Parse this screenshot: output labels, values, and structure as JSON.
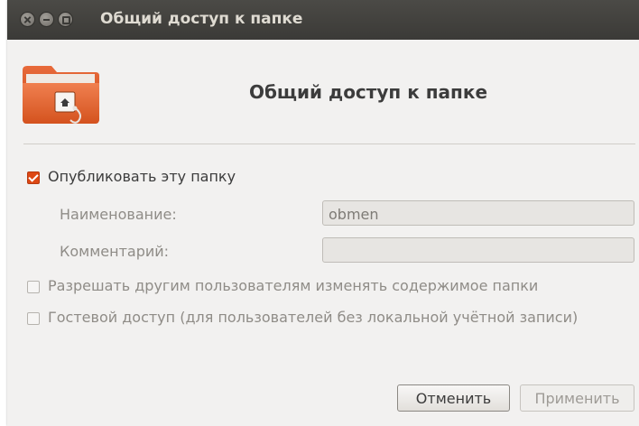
{
  "window": {
    "title": "Общий доступ к папке",
    "controls": [
      "close-icon",
      "minimize-icon",
      "maximize-icon"
    ]
  },
  "header": {
    "icon": "folder-share-icon",
    "title": "Общий доступ к папке"
  },
  "options": {
    "publish_label": "Опубликовать эту папку",
    "publish_checked": true,
    "name_label": "Наименование:",
    "name_value": "obmen",
    "comment_label": "Комментарий:",
    "comment_value": "",
    "allow_modify_label": "Разрешать другим пользователям изменять содержимое папки",
    "allow_modify_checked": false,
    "guest_label": "Гостевой доступ (для пользователей без локальной учётной записи)",
    "guest_checked": false
  },
  "buttons": {
    "cancel_label": "Отменить",
    "apply_label": "Применить"
  },
  "colors": {
    "accent": "#dd4814",
    "titlebar": "#3c3b37",
    "window_bg": "#f2f1f0"
  }
}
